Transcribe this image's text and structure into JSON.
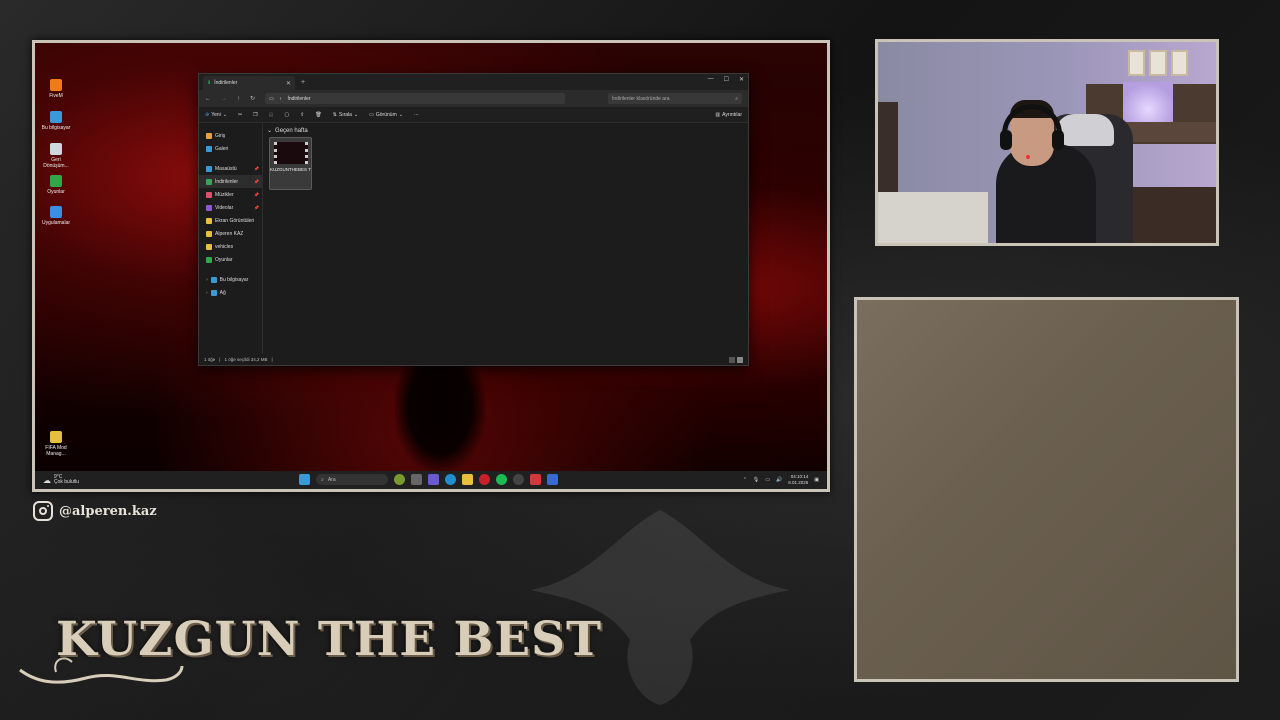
{
  "desktop": {
    "icons": [
      {
        "label": "FiveM"
      },
      {
        "label": "Bu bilgisayar"
      },
      {
        "label": "Geri Dönüşüm..."
      },
      {
        "label": "Oyunlar"
      },
      {
        "label": "Uygulamalar"
      },
      {
        "label": "FIFA Mod Manag..."
      }
    ]
  },
  "explorer": {
    "tab_title": "İndirilenler",
    "address_path": "İndirilenler",
    "search_placeholder": "İndirilenler klasöründe ara",
    "toolbar": {
      "new_label": "Yeni",
      "sort_label": "Sırala",
      "view_label": "Görünüm",
      "details_label": "Ayrıntılar"
    },
    "nav": {
      "quick": [
        "Giriş",
        "Galeri"
      ],
      "pinned": [
        "Masaüstü",
        "İndirilenler",
        "Müzikler",
        "Videolar"
      ],
      "folders": [
        "Ekran Görüntüleri",
        "Alperen KAZ",
        "vehicles",
        "Oyunlar"
      ],
      "roots": [
        "Bu bilgisayar",
        "Ağ"
      ]
    },
    "group_header": "Geçen hafta",
    "file": {
      "name": "KUZGUNTHEBES T"
    },
    "status": {
      "count": "1 öğe",
      "selected": "1 öğe seçildi 34,2 MB"
    }
  },
  "taskbar": {
    "weather_temp": "9°C",
    "weather_desc": "Çok bulutlu",
    "search_label": "Ara",
    "time": "04:10:14",
    "date": "8.01.2026"
  },
  "overlay": {
    "instagram_handle": "@alperen.kaz",
    "brand_title": "KUZGUN THE BEST",
    "frame_color": "#c9c3b8",
    "panel_color": "#6b6050"
  }
}
